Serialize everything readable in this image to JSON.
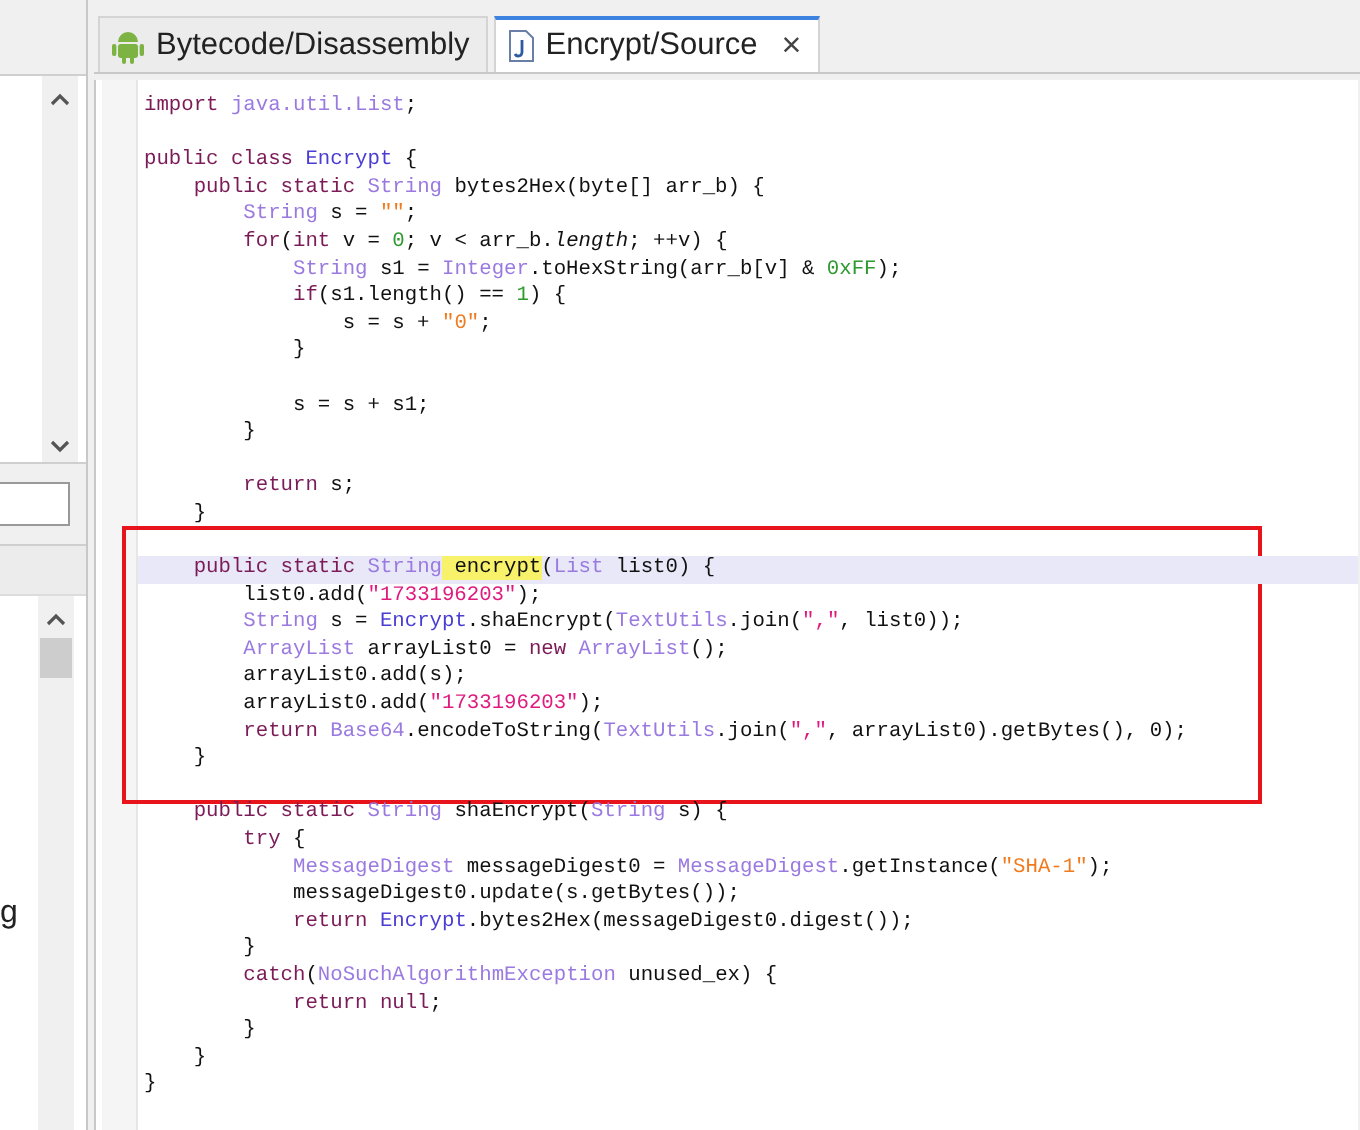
{
  "side_panel": {
    "cut_text": "g"
  },
  "tabs": [
    {
      "label": "Bytecode/Disassembly",
      "kind": "android",
      "selected": false
    },
    {
      "label": "Encrypt/Source",
      "kind": "source",
      "selected": true,
      "close": "×"
    }
  ],
  "code": {
    "blocks": [
      {
        "boxed": false,
        "lines": [
          {
            "kind": "code",
            "tokens": [
              {
                "kind": "kw",
                "text": "import "
              },
              {
                "kind": "type",
                "text": "java.util.List"
              },
              {
                "kind": "p",
                "text": ";"
              }
            ]
          },
          {
            "kind": "blank"
          },
          {
            "kind": "code",
            "tokens": [
              {
                "kind": "kw",
                "text": "public class "
              },
              {
                "kind": "cls",
                "text": "Encrypt"
              },
              {
                "kind": "p",
                "text": " {"
              }
            ]
          },
          {
            "kind": "code",
            "tokens": [
              {
                "kind": "kw",
                "text": "    public static "
              },
              {
                "kind": "type",
                "text": "String"
              },
              {
                "kind": "p",
                "text": " bytes2Hex(byte[] arr_b) {"
              }
            ]
          },
          {
            "kind": "code",
            "tokens": [
              {
                "kind": "type",
                "text": "        String"
              },
              {
                "kind": "p",
                "text": " s = "
              },
              {
                "kind": "str2",
                "text": "\"\""
              },
              {
                "kind": "p",
                "text": ";"
              }
            ]
          },
          {
            "kind": "code",
            "tokens": [
              {
                "kind": "kw",
                "text": "        for"
              },
              {
                "kind": "p",
                "text": "("
              },
              {
                "kind": "kw",
                "text": "int"
              },
              {
                "kind": "p",
                "text": " v = "
              },
              {
                "kind": "num",
                "text": "0"
              },
              {
                "kind": "p",
                "text": "; v < arr_b."
              },
              {
                "kind": "field",
                "text": "length"
              },
              {
                "kind": "p",
                "text": "; ++v) {"
              }
            ]
          },
          {
            "kind": "code",
            "tokens": [
              {
                "kind": "type",
                "text": "            String"
              },
              {
                "kind": "p",
                "text": " s1 = "
              },
              {
                "kind": "type",
                "text": "Integer"
              },
              {
                "kind": "p",
                "text": ".toHexString(arr_b[v] & "
              },
              {
                "kind": "num",
                "text": "0xFF"
              },
              {
                "kind": "p",
                "text": ");"
              }
            ]
          },
          {
            "kind": "code",
            "tokens": [
              {
                "kind": "kw",
                "text": "            if"
              },
              {
                "kind": "p",
                "text": "(s1.length() == "
              },
              {
                "kind": "num",
                "text": "1"
              },
              {
                "kind": "p",
                "text": ") {"
              }
            ]
          },
          {
            "kind": "code",
            "tokens": [
              {
                "kind": "p",
                "text": "                s = s + "
              },
              {
                "kind": "str2",
                "text": "\"0\""
              },
              {
                "kind": "p",
                "text": ";"
              }
            ]
          },
          {
            "kind": "code",
            "tokens": [
              {
                "kind": "p",
                "text": "            }"
              }
            ]
          },
          {
            "kind": "blank"
          },
          {
            "kind": "code",
            "tokens": [
              {
                "kind": "p",
                "text": "            s = s + s1;"
              }
            ]
          },
          {
            "kind": "code",
            "tokens": [
              {
                "kind": "p",
                "text": "        }"
              }
            ]
          },
          {
            "kind": "blank"
          },
          {
            "kind": "code",
            "tokens": [
              {
                "kind": "kw",
                "text": "        return"
              },
              {
                "kind": "p",
                "text": " s;"
              }
            ]
          },
          {
            "kind": "code",
            "tokens": [
              {
                "kind": "p",
                "text": "    }"
              }
            ]
          }
        ]
      },
      {
        "boxed": true,
        "lines": [
          {
            "kind": "blank"
          },
          {
            "kind": "code",
            "current": true,
            "tokens": [
              {
                "kind": "kw",
                "text": "    public static "
              },
              {
                "kind": "type",
                "text": "String"
              },
              {
                "kind": "hl",
                "text": " encrypt"
              },
              {
                "kind": "p",
                "text": "("
              },
              {
                "kind": "type",
                "text": "List"
              },
              {
                "kind": "p",
                "text": " list0) {"
              }
            ]
          },
          {
            "kind": "code",
            "tokens": [
              {
                "kind": "p",
                "text": "        list0.add("
              },
              {
                "kind": "str",
                "text": "\"1733196203\""
              },
              {
                "kind": "p",
                "text": ");"
              }
            ]
          },
          {
            "kind": "code",
            "tokens": [
              {
                "kind": "type",
                "text": "        String"
              },
              {
                "kind": "p",
                "text": " s = "
              },
              {
                "kind": "cls",
                "text": "Encrypt"
              },
              {
                "kind": "p",
                "text": ".shaEncrypt("
              },
              {
                "kind": "type",
                "text": "TextUtils"
              },
              {
                "kind": "p",
                "text": ".join("
              },
              {
                "kind": "str",
                "text": "\",\""
              },
              {
                "kind": "p",
                "text": ", list0));"
              }
            ]
          },
          {
            "kind": "code",
            "tokens": [
              {
                "kind": "type",
                "text": "        ArrayList"
              },
              {
                "kind": "p",
                "text": " arrayList0 = "
              },
              {
                "kind": "kw",
                "text": "new "
              },
              {
                "kind": "type",
                "text": "ArrayList"
              },
              {
                "kind": "p",
                "text": "();"
              }
            ]
          },
          {
            "kind": "code",
            "tokens": [
              {
                "kind": "p",
                "text": "        arrayList0.add(s);"
              }
            ]
          },
          {
            "kind": "code",
            "tokens": [
              {
                "kind": "p",
                "text": "        arrayList0.add("
              },
              {
                "kind": "str",
                "text": "\"1733196203\""
              },
              {
                "kind": "p",
                "text": ");"
              }
            ]
          },
          {
            "kind": "code",
            "tokens": [
              {
                "kind": "kw",
                "text": "        return "
              },
              {
                "kind": "type",
                "text": "Base64"
              },
              {
                "kind": "p",
                "text": ".encodeToString("
              },
              {
                "kind": "type",
                "text": "TextUtils"
              },
              {
                "kind": "p",
                "text": ".join("
              },
              {
                "kind": "str",
                "text": "\",\""
              },
              {
                "kind": "p",
                "text": ", arrayList0).getBytes(), 0);"
              }
            ]
          },
          {
            "kind": "code",
            "tokens": [
              {
                "kind": "p",
                "text": "    }"
              }
            ]
          },
          {
            "kind": "blank"
          }
        ]
      },
      {
        "boxed": false,
        "lines": [
          {
            "kind": "code",
            "tokens": [
              {
                "kind": "kw",
                "text": "    public static "
              },
              {
                "kind": "type",
                "text": "String"
              },
              {
                "kind": "p",
                "text": " shaEncrypt("
              },
              {
                "kind": "type",
                "text": "String"
              },
              {
                "kind": "p",
                "text": " s) {"
              }
            ]
          },
          {
            "kind": "code",
            "tokens": [
              {
                "kind": "kw",
                "text": "        try"
              },
              {
                "kind": "p",
                "text": " {"
              }
            ]
          },
          {
            "kind": "code",
            "tokens": [
              {
                "kind": "type",
                "text": "            MessageDigest"
              },
              {
                "kind": "p",
                "text": " messageDigest0 = "
              },
              {
                "kind": "type",
                "text": "MessageDigest"
              },
              {
                "kind": "p",
                "text": ".getInstance("
              },
              {
                "kind": "str2",
                "text": "\"SHA-1\""
              },
              {
                "kind": "p",
                "text": ");"
              }
            ]
          },
          {
            "kind": "code",
            "tokens": [
              {
                "kind": "p",
                "text": "            messageDigest0.update(s.getBytes());"
              }
            ]
          },
          {
            "kind": "code",
            "tokens": [
              {
                "kind": "kw",
                "text": "            return "
              },
              {
                "kind": "cls",
                "text": "Encrypt"
              },
              {
                "kind": "p",
                "text": ".bytes2Hex(messageDigest0.digest());"
              }
            ]
          },
          {
            "kind": "code",
            "tokens": [
              {
                "kind": "p",
                "text": "        }"
              }
            ]
          },
          {
            "kind": "code",
            "tokens": [
              {
                "kind": "kw",
                "text": "        catch"
              },
              {
                "kind": "p",
                "text": "("
              },
              {
                "kind": "type",
                "text": "NoSuchAlgorithmException"
              },
              {
                "kind": "p",
                "text": " unused_ex) {"
              }
            ]
          },
          {
            "kind": "code",
            "tokens": [
              {
                "kind": "kw",
                "text": "            return null"
              },
              {
                "kind": "p",
                "text": ";"
              }
            ]
          },
          {
            "kind": "code",
            "tokens": [
              {
                "kind": "p",
                "text": "        }"
              }
            ]
          },
          {
            "kind": "code",
            "tokens": [
              {
                "kind": "p",
                "text": "    }"
              }
            ]
          },
          {
            "kind": "code",
            "tokens": [
              {
                "kind": "p",
                "text": "}"
              }
            ]
          }
        ]
      }
    ]
  }
}
